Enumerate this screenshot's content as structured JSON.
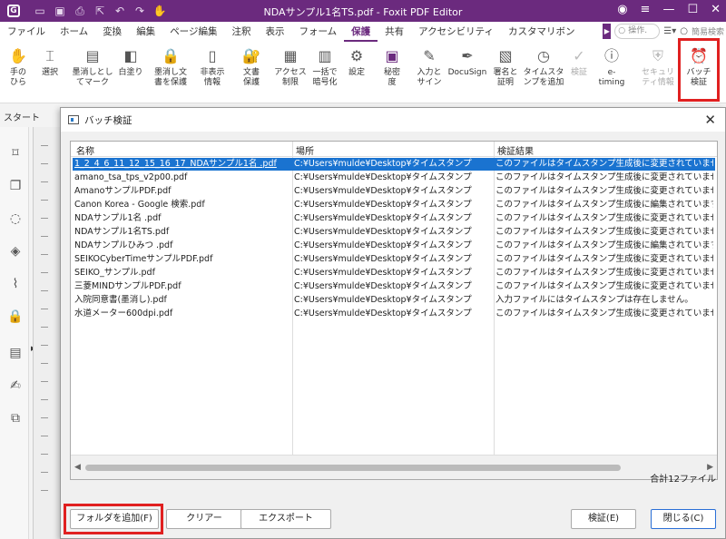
{
  "window": {
    "title": "NDAサンプル1名TS.pdf - Foxit PDF Editor",
    "logo": "G"
  },
  "titlebar_icons": [
    "folder-icon",
    "save-icon",
    "print-icon",
    "export-icon",
    "undo-icon",
    "redo-icon",
    "hand-icon"
  ],
  "menu": {
    "items": [
      "ファイル",
      "ホーム",
      "変換",
      "編集",
      "ページ編集",
      "注釈",
      "表示",
      "フォーム",
      "保護",
      "共有",
      "アクセシビリティ",
      "カスタマリボン"
    ],
    "active": "保護",
    "search_operation": "操作.",
    "search_simple": "簡易検索"
  },
  "ribbon": {
    "hand": "手の\nひら",
    "select": "選択",
    "redact_mark": "墨消しとし\nてマーク",
    "whiteout": "白塗り",
    "redact_protect": "墨消し文\n書を保護",
    "hidden_info": "非表示\n情報",
    "doc_protect": "文書\n保護",
    "access_restrict": "アクセス\n制限",
    "bulk_encrypt": "一括で\n暗号化",
    "settings": "設定",
    "confidential": "秘密\n度",
    "fill_sign": "入力と\nサイン",
    "docusign": "DocuSign",
    "sign_certify": "署名と\n証明",
    "timestamp_add": "タイムスタ\nンプを追加",
    "verify": "検証",
    "etiming": "e-\ntiming",
    "security_info": "セキュリ\nティ情報",
    "batch_verify": "バッチ\n検証"
  },
  "tab": {
    "start": "スタート"
  },
  "dialog": {
    "title": "バッチ検証",
    "columns": [
      "名称",
      "場所",
      "検証結果"
    ],
    "rows": [
      [
        "1_2_4_6_11_12_15_16_17_NDAサンプル1名 .pdf",
        "C:¥Users¥mulde¥Desktop¥タイムスタンプ",
        "このファイルはタイムスタンプ生成後に変更されていません。"
      ],
      [
        "amano_tsa_tps_v2p00.pdf",
        "C:¥Users¥mulde¥Desktop¥タイムスタンプ",
        "このファイルはタイムスタンプ生成後に変更されていません。"
      ],
      [
        "AmanoサンプルPDF.pdf",
        "C:¥Users¥mulde¥Desktop¥タイムスタンプ",
        "このファイルはタイムスタンプ生成後に変更されていません。"
      ],
      [
        "Canon Korea - Google 検索.pdf",
        "C:¥Users¥mulde¥Desktop¥タイムスタンプ",
        "このファイルはタイムスタンプ生成後に編集されています。"
      ],
      [
        "NDAサンプル1名 .pdf",
        "C:¥Users¥mulde¥Desktop¥タイムスタンプ",
        "このファイルはタイムスタンプ生成後に変更されていません。"
      ],
      [
        "NDAサンプル1名TS.pdf",
        "C:¥Users¥mulde¥Desktop¥タイムスタンプ",
        "このファイルはタイムスタンプ生成後に変更されていません。"
      ],
      [
        "NDAサンプルひみつ .pdf",
        "C:¥Users¥mulde¥Desktop¥タイムスタンプ",
        "このファイルはタイムスタンプ生成後に編集されています。"
      ],
      [
        "SEIKOCyberTimeサンプルPDF.pdf",
        "C:¥Users¥mulde¥Desktop¥タイムスタンプ",
        "このファイルはタイムスタンプ生成後に変更されていません。"
      ],
      [
        "SEIKO_サンプル.pdf",
        "C:¥Users¥mulde¥Desktop¥タイムスタンプ",
        "このファイルはタイムスタンプ生成後に変更されていません。"
      ],
      [
        "三菱MINDサンプルPDF.pdf",
        "C:¥Users¥mulde¥Desktop¥タイムスタンプ",
        "このファイルはタイムスタンプ生成後に変更されていません。"
      ],
      [
        "入院同意書(墨消し).pdf",
        "C:¥Users¥mulde¥Desktop¥タイムスタンプ",
        "入力ファイルにはタイムスタンプは存在しません。"
      ],
      [
        "水道メーター600dpi.pdf",
        "C:¥Users¥mulde¥Desktop¥タイムスタンプ",
        "このファイルはタイムスタンプ生成後に変更されていません。"
      ]
    ],
    "total": "合計12ファイル",
    "buttons": {
      "add_folder": "フォルダを追加(F)",
      "clear": "クリアー",
      "export": "エクスポート",
      "verify": "検証(E)",
      "close": "閉じる(C)"
    }
  },
  "colors": {
    "brand": "#6b2a7e",
    "selection": "#1a73d0",
    "highlight": "#e02020"
  }
}
